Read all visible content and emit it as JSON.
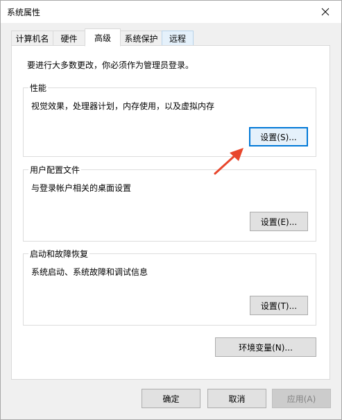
{
  "window": {
    "title": "系统属性"
  },
  "tabs": [
    {
      "label": "计算机名"
    },
    {
      "label": "硬件"
    },
    {
      "label": "高级"
    },
    {
      "label": "系统保护"
    },
    {
      "label": "远程"
    }
  ],
  "intro_text": "要进行大多数更改，你必须作为管理员登录。",
  "groups": {
    "performance": {
      "label": "性能",
      "description": "视觉效果，处理器计划，内存使用，以及虚拟内存",
      "button": "设置(S)..."
    },
    "profiles": {
      "label": "用户配置文件",
      "description": "与登录帐户相关的桌面设置",
      "button": "设置(E)..."
    },
    "startup": {
      "label": "启动和故障恢复",
      "description": "系统启动、系统故障和调试信息",
      "button": "设置(T)..."
    }
  },
  "env_button": "环境变量(N)...",
  "footer": {
    "ok": "确定",
    "cancel": "取消",
    "apply": "应用(A)"
  },
  "colors": {
    "accent": "#0078d7",
    "annotation_arrow": "#e8462c"
  }
}
